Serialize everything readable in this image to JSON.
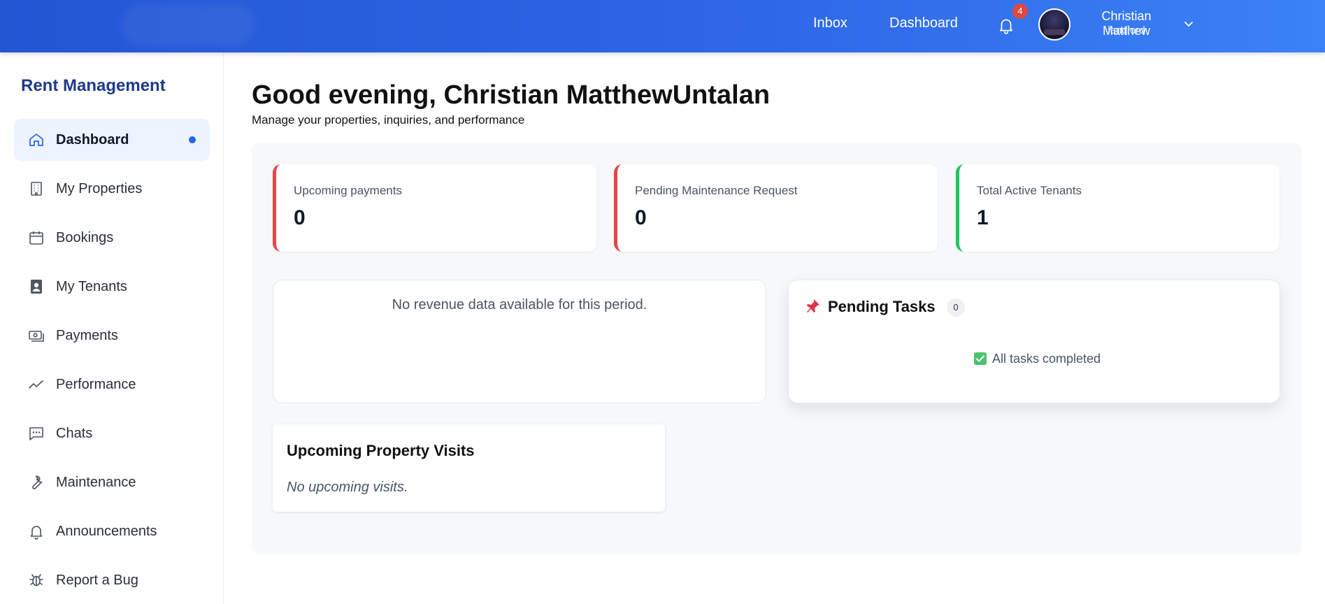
{
  "header": {
    "nav": {
      "inbox": "Inbox",
      "dashboard": "Dashboard"
    },
    "notifications": {
      "icon": "bell-icon",
      "count": "4"
    },
    "user": {
      "name": "Christian Matthew",
      "role": "landlord",
      "menu_icon": "chevron-down-icon"
    },
    "colors": {
      "gradient_start": "#2356d3",
      "gradient_end": "#3b82f6",
      "badge": "#e0483f"
    }
  },
  "sidebar": {
    "brand": "Rent Management",
    "items": [
      {
        "label": "Dashboard",
        "icon": "home-icon",
        "active": true
      },
      {
        "label": "My Properties",
        "icon": "building-icon"
      },
      {
        "label": "Bookings",
        "icon": "calendar-icon"
      },
      {
        "label": "My Tenants",
        "icon": "person-badge-icon"
      },
      {
        "label": "Payments",
        "icon": "cash-icon"
      },
      {
        "label": "Performance",
        "icon": "trend-icon"
      },
      {
        "label": "Chats",
        "icon": "chat-icon"
      },
      {
        "label": "Maintenance",
        "icon": "wrench-icon"
      },
      {
        "label": "Announcements",
        "icon": "bell-icon"
      },
      {
        "label": "Report a Bug",
        "icon": "bug-icon"
      }
    ],
    "active_color": "#2563eb"
  },
  "main": {
    "greeting": "Good evening, Christian MatthewUntalan",
    "subtitle": "Manage your properties, inquiries, and performance",
    "stats": [
      {
        "label": "Upcoming payments",
        "value": "0",
        "accent": "#e14848"
      },
      {
        "label": "Pending Maintenance Request",
        "value": "0",
        "accent": "#e14848"
      },
      {
        "label": "Total Active Tenants",
        "value": "1",
        "accent": "#22c55e"
      }
    ],
    "revenue": {
      "message": "No revenue data available for this period."
    },
    "tasks": {
      "title": "Pending Tasks",
      "count": "0",
      "icon": "pushpin-icon",
      "status": "All tasks completed",
      "status_icon": "checkbox-icon"
    },
    "visits": {
      "title": "Upcoming Property Visits",
      "empty": "No upcoming visits."
    }
  }
}
